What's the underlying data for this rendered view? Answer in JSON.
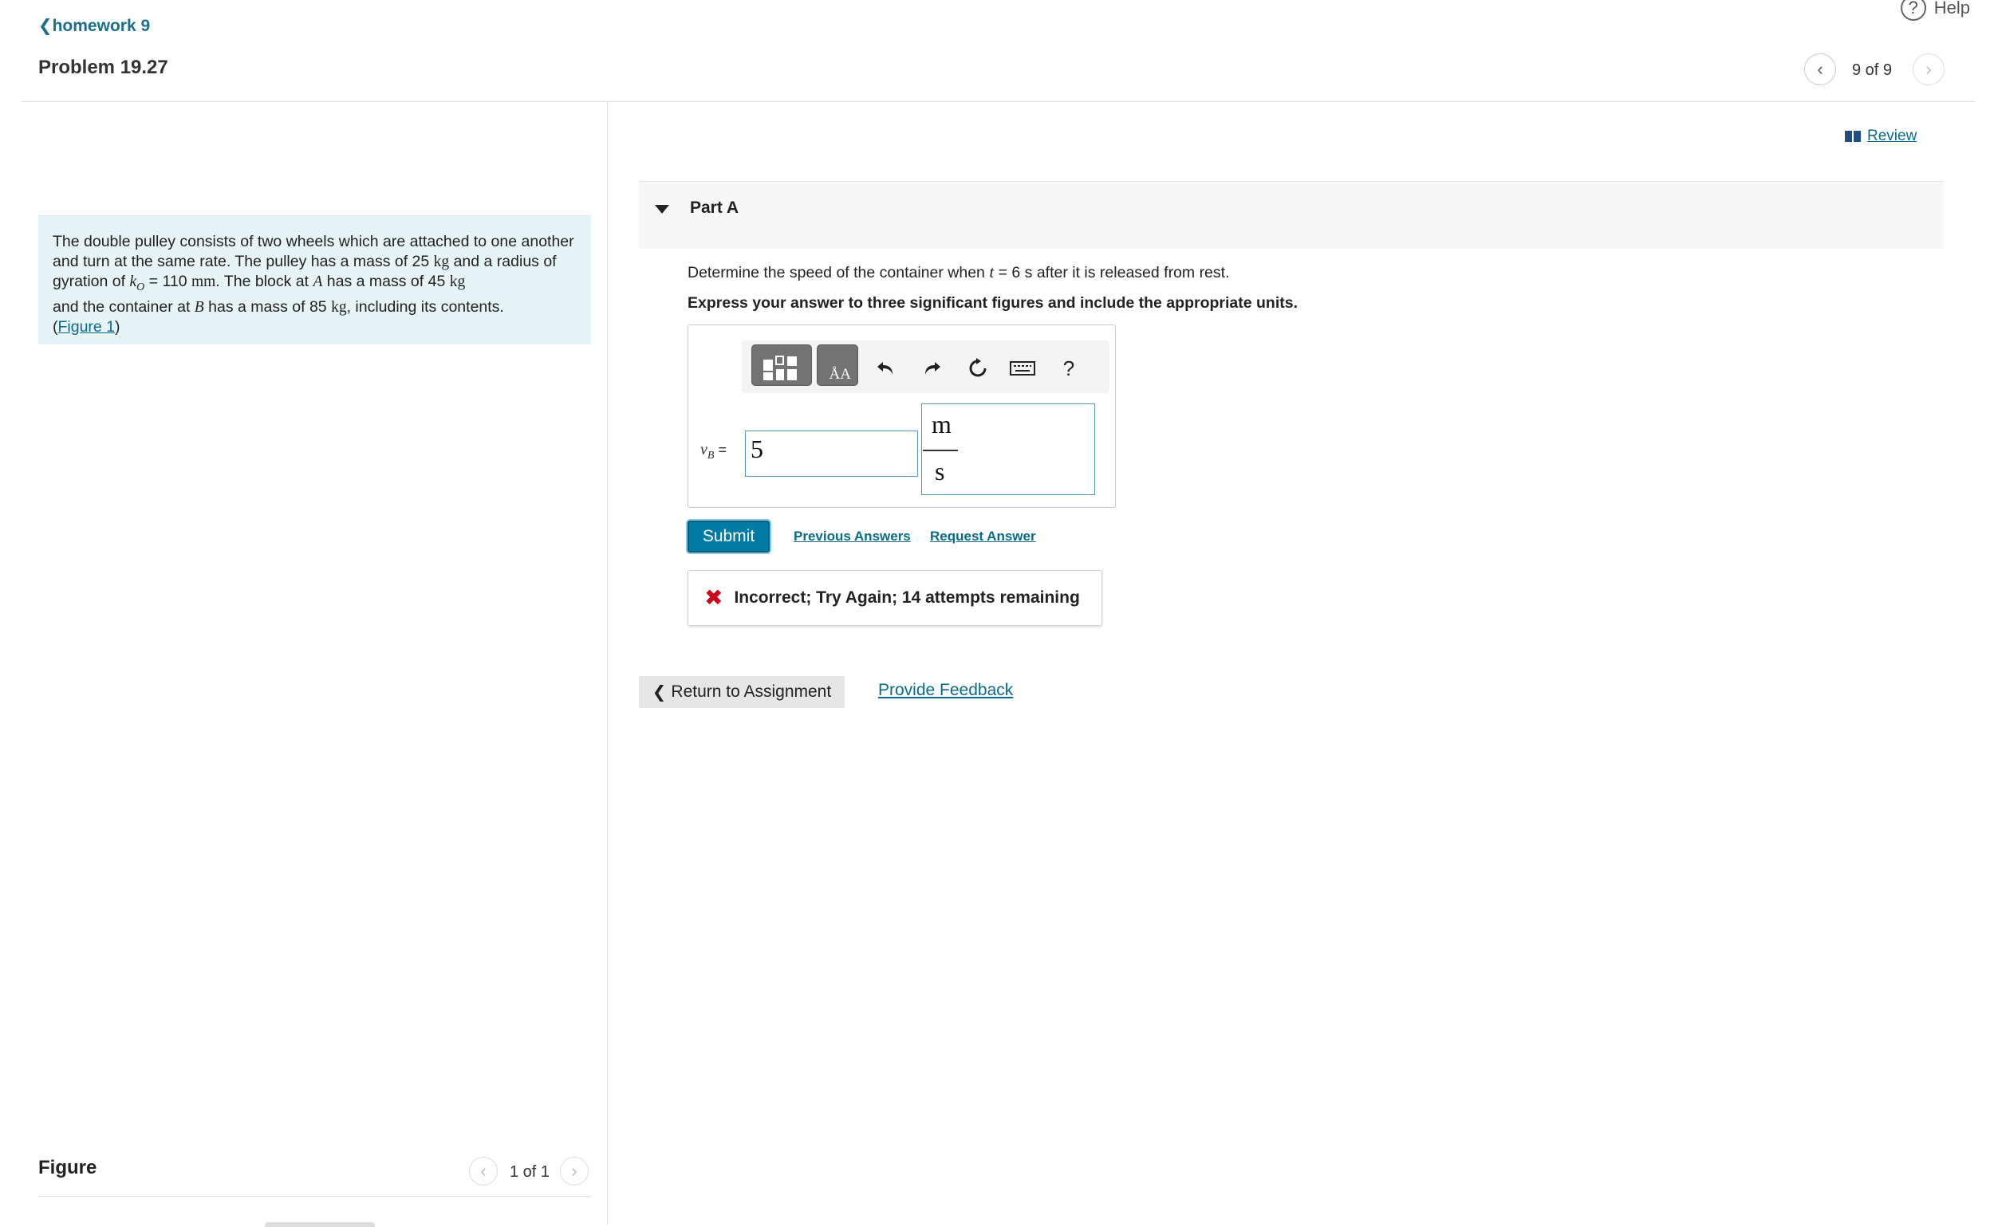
{
  "header": {
    "back_label": "homework 9",
    "help_label": "Help",
    "problem_title": "Problem 19.27",
    "pager": {
      "text": "9 of 9"
    }
  },
  "problem": {
    "text_1": "The double pulley consists of two wheels which are attached to one another and turn at the same rate. The pulley has a mass of 25 ",
    "unit_kg": "kg",
    "text_2": " and a radius of gyration of ",
    "k_symbol": "k",
    "k_sub": "O",
    "text_3": " = 110 ",
    "unit_mm": "mm",
    "text_4": ". The block at ",
    "point_a": "A",
    "text_5": " has a mass of 45 ",
    "text_6": " and the container at ",
    "point_b": "B",
    "text_7": " has a mass of 85 ",
    "text_8": ", including its contents.",
    "figure_link": "Figure 1"
  },
  "figure": {
    "title": "Figure",
    "pager_text": "1 of 1"
  },
  "review_label": "Review",
  "part": {
    "label": "Part A",
    "question_1": "Determine the speed of the container when ",
    "question_var": "t",
    "question_2": " = 6 s after it is released from rest.",
    "instruction": "Express your answer to three significant figures and include the appropriate units."
  },
  "answer": {
    "var_symbol": "v",
    "var_sub": "B",
    "equals": " =",
    "value": "5",
    "unit_numerator": "m",
    "unit_denominator": "s",
    "toolbar_tiles_text": "ÅA",
    "toolbar_help": "?"
  },
  "actions": {
    "submit_label": "Submit",
    "previous_answers_label": "Previous Answers",
    "request_answer_label": "Request Answer"
  },
  "feedback": {
    "message": "Incorrect; Try Again; 14 attempts remaining"
  },
  "footer": {
    "return_label": "Return to Assignment",
    "provide_feedback_label": "Provide Feedback"
  }
}
